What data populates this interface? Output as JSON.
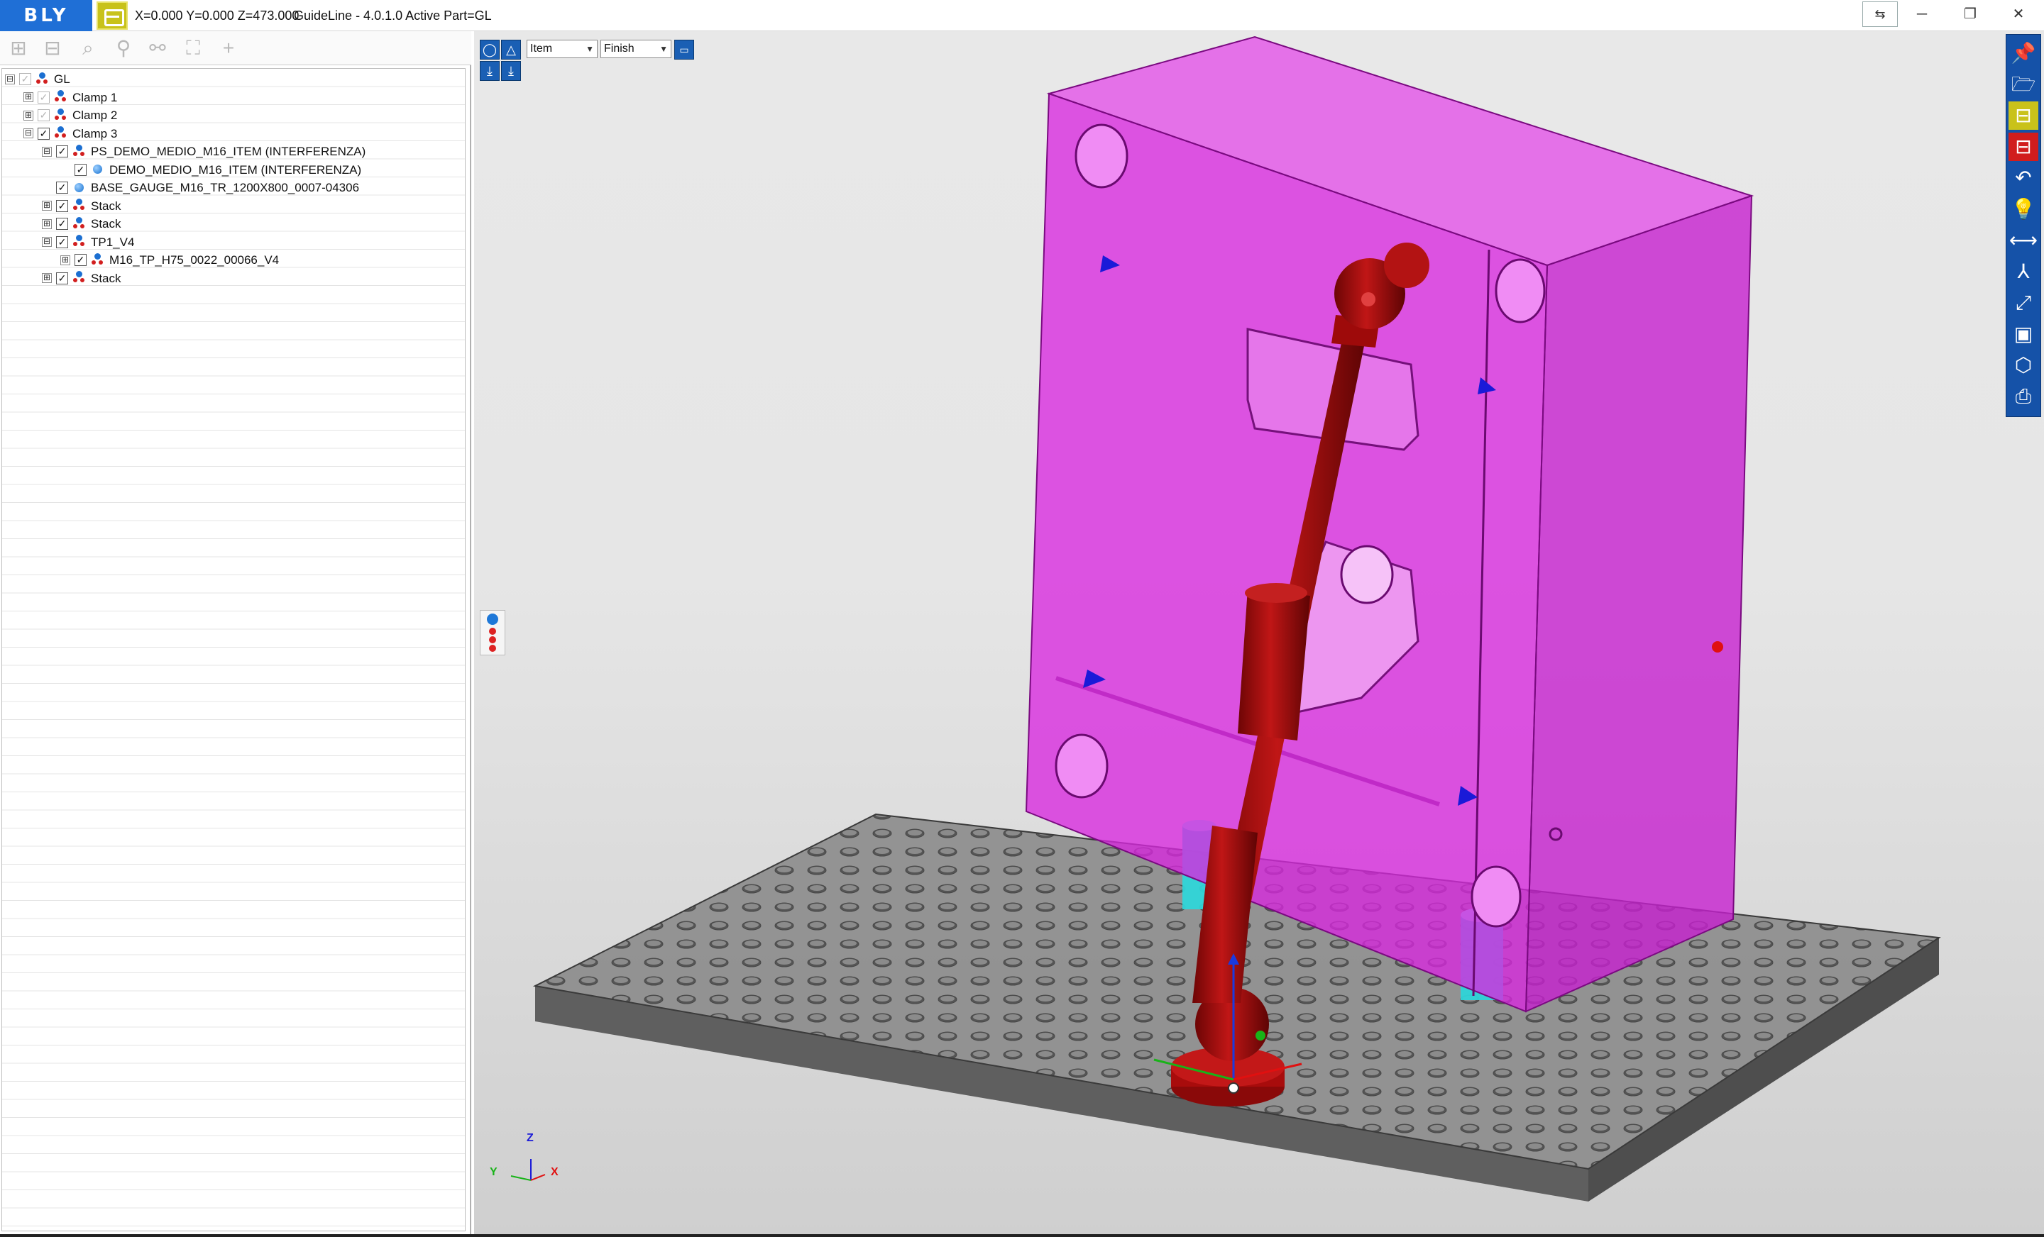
{
  "titlebar": {
    "logo": "BLY",
    "coords": "X=0.000 Y=0.000 Z=473.000",
    "app_title": "GuideLine - 4.0.1.0 Active Part=GL",
    "minimize": "─",
    "restore": "❐",
    "close": "✕"
  },
  "tree_toolbar": {
    "add_icon": "plus-square-icon",
    "remove_icon": "minus-square-icon",
    "search_icon": "search-icon",
    "hierarchy_icon": "tree-icon",
    "hierarchy2_icon": "tree-branch-icon",
    "fit_icon": "fit-icon",
    "crosshair_icon": "plus-icon"
  },
  "tree": [
    {
      "label": "GL",
      "level": 0,
      "expander": "⊟",
      "checked": "✓",
      "dim": true,
      "icon": "assy"
    },
    {
      "label": "Clamp 1",
      "level": 1,
      "expander": "⊞",
      "checked": "✓",
      "dim": true,
      "icon": "assy"
    },
    {
      "label": "Clamp 2",
      "level": 1,
      "expander": "⊞",
      "checked": "✓",
      "dim": true,
      "icon": "assy"
    },
    {
      "label": "Clamp 3",
      "level": 1,
      "expander": "⊟",
      "checked": "✓",
      "dim": false,
      "icon": "assy"
    },
    {
      "label": "PS_DEMO_MEDIO_M16_ITEM (INTERFERENZA)",
      "level": 2,
      "expander": "⊟",
      "checked": "✓",
      "dim": false,
      "icon": "assy"
    },
    {
      "label": "DEMO_MEDIO_M16_ITEM (INTERFERENZA)",
      "level": 3,
      "expander": "",
      "checked": "✓",
      "dim": false,
      "icon": "part"
    },
    {
      "label": "BASE_GAUGE_M16_TR_1200X800_0007-04306",
      "level": 2,
      "expander": "",
      "checked": "✓",
      "dim": false,
      "icon": "part"
    },
    {
      "label": "Stack",
      "level": 2,
      "expander": "⊞",
      "checked": "✓",
      "dim": false,
      "icon": "assy"
    },
    {
      "label": "Stack",
      "level": 2,
      "expander": "⊞",
      "checked": "✓",
      "dim": false,
      "icon": "assy"
    },
    {
      "label": "TP1_V4",
      "level": 2,
      "expander": "⊟",
      "checked": "✓",
      "dim": false,
      "icon": "assy"
    },
    {
      "label": "M16_TP_H75_0022_00066_V4",
      "level": 3,
      "expander": "⊞",
      "checked": "✓",
      "dim": false,
      "icon": "assy"
    },
    {
      "label": "Stack",
      "level": 2,
      "expander": "⊞",
      "checked": "✓",
      "dim": false,
      "icon": "assy"
    }
  ],
  "viewport": {
    "mode_select": "Item",
    "finish_select": "Finish",
    "axis_labels": {
      "z": "Z",
      "y": "Y",
      "x": "X"
    },
    "colors": {
      "mold": "#e018e6",
      "arm": "#a80c0c",
      "plate": "#7a7a7a",
      "spacer": "#2fd5d8",
      "marker": "#1a1ad8"
    }
  },
  "right_toolbar": [
    {
      "name": "pin-icon",
      "glyph": "📌",
      "style": ""
    },
    {
      "name": "open-folder-icon",
      "glyph": "🗁",
      "style": ""
    },
    {
      "name": "gauge-yellow-icon",
      "glyph": "⊟",
      "style": "yellow"
    },
    {
      "name": "gauge-red-icon",
      "glyph": "⊟",
      "style": "red"
    },
    {
      "name": "undo-icon",
      "glyph": "↶",
      "style": ""
    },
    {
      "name": "bulb-icon",
      "glyph": "💡",
      "style": ""
    },
    {
      "name": "measure-icon",
      "glyph": "⟷",
      "style": ""
    },
    {
      "name": "axes-icon",
      "glyph": "⅄",
      "style": ""
    },
    {
      "name": "expand-icon",
      "glyph": "⤢",
      "style": ""
    },
    {
      "name": "view-box-icon",
      "glyph": "▣",
      "style": ""
    },
    {
      "name": "cube-icon",
      "glyph": "⬡",
      "style": ""
    },
    {
      "name": "print-icon",
      "glyph": "⎙",
      "style": ""
    }
  ]
}
